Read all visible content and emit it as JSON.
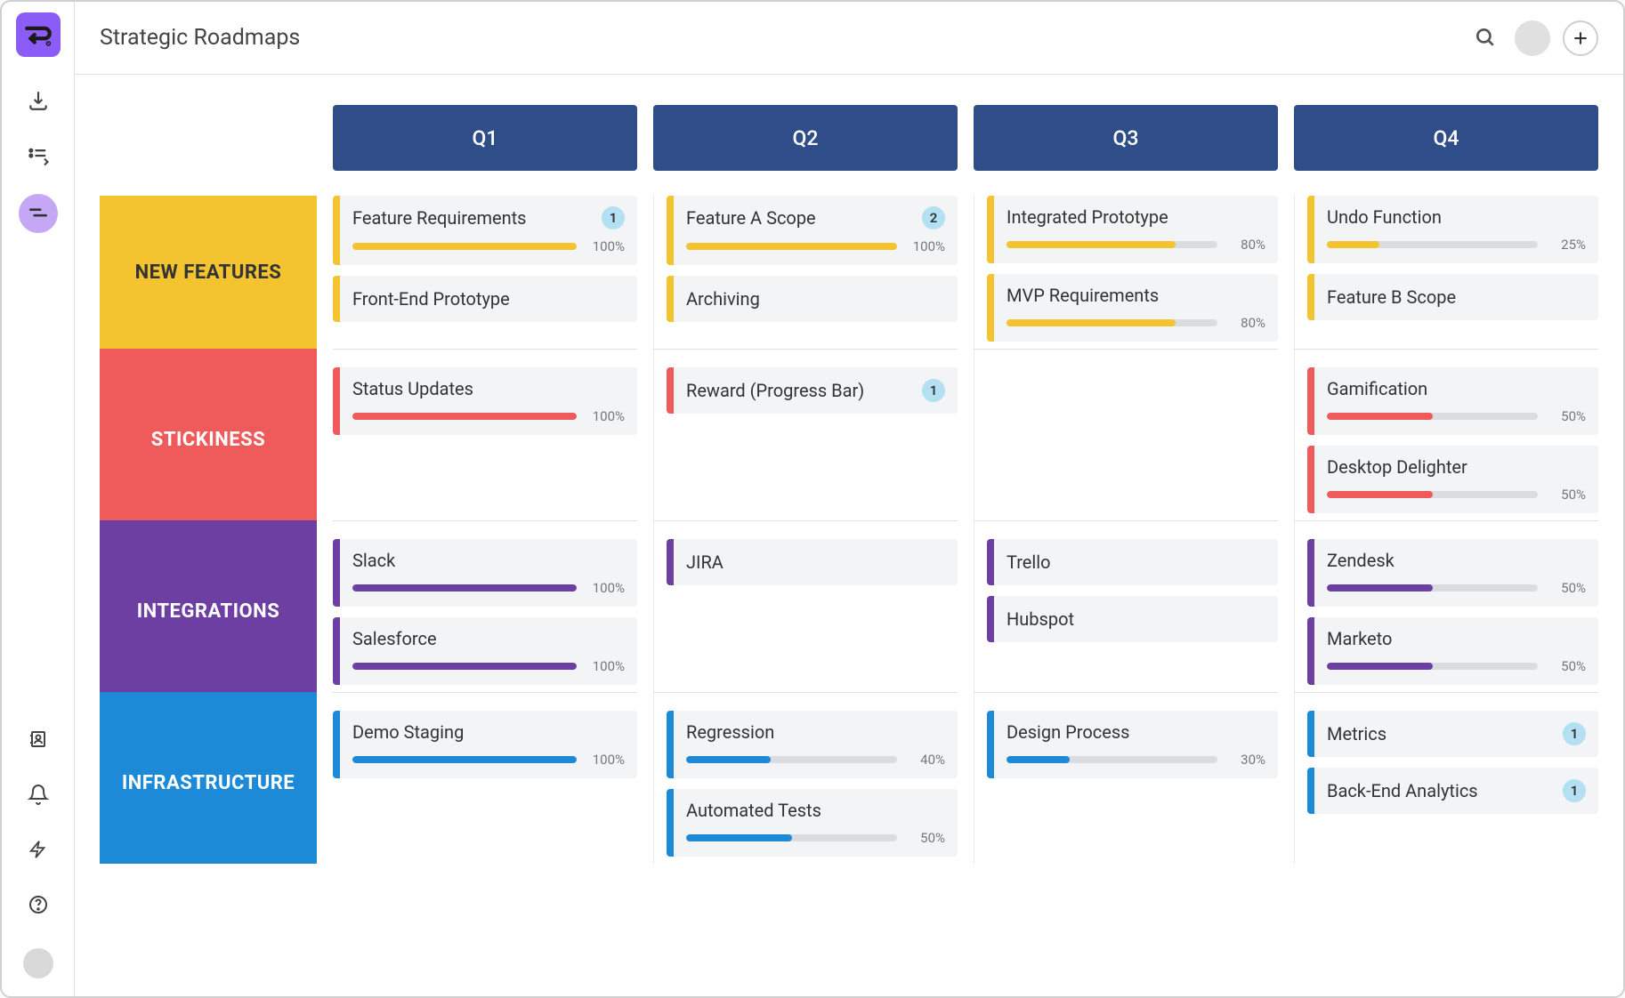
{
  "header": {
    "title": "Strategic Roadmaps"
  },
  "columns": [
    "Q1",
    "Q2",
    "Q3",
    "Q4"
  ],
  "lanes": [
    {
      "name": "NEW FEATURES",
      "color": "yellow",
      "cells": [
        [
          {
            "title": "Feature Requirements",
            "badge": 1,
            "progress": 100
          },
          {
            "title": "Front-End Prototype"
          }
        ],
        [
          {
            "title": "Feature A Scope",
            "badge": 2,
            "progress": 100
          },
          {
            "title": "Archiving"
          }
        ],
        [
          {
            "title": "Integrated Prototype",
            "progress": 80
          },
          {
            "title": "MVP Requirements",
            "progress": 80
          }
        ],
        [
          {
            "title": "Undo Function",
            "progress": 25
          },
          {
            "title": "Feature B Scope"
          }
        ]
      ]
    },
    {
      "name": "STICKINESS",
      "color": "red",
      "cells": [
        [
          {
            "title": "Status Updates",
            "progress": 100
          }
        ],
        [
          {
            "title": "Reward (Progress Bar)",
            "badge": 1
          }
        ],
        [],
        [
          {
            "title": "Gamification",
            "progress": 50
          },
          {
            "title": "Desktop Delighter",
            "progress": 50
          }
        ]
      ]
    },
    {
      "name": "INTEGRATIONS",
      "color": "purple",
      "cells": [
        [
          {
            "title": "Slack",
            "progress": 100
          },
          {
            "title": "Salesforce",
            "progress": 100
          }
        ],
        [
          {
            "title": "JIRA"
          }
        ],
        [
          {
            "title": "Trello"
          },
          {
            "title": "Hubspot"
          }
        ],
        [
          {
            "title": "Zendesk",
            "progress": 50
          },
          {
            "title": "Marketo",
            "progress": 50
          }
        ]
      ]
    },
    {
      "name": "INFRASTRUCTURE",
      "color": "blue",
      "cells": [
        [
          {
            "title": "Demo Staging",
            "progress": 100
          }
        ],
        [
          {
            "title": "Regression",
            "progress": 40
          },
          {
            "title": "Automated Tests",
            "progress": 50
          }
        ],
        [
          {
            "title": "Design Process",
            "progress": 30
          }
        ],
        [
          {
            "title": "Metrics",
            "badge": 1
          },
          {
            "title": "Back-End Analytics",
            "badge": 1
          }
        ]
      ]
    }
  ]
}
